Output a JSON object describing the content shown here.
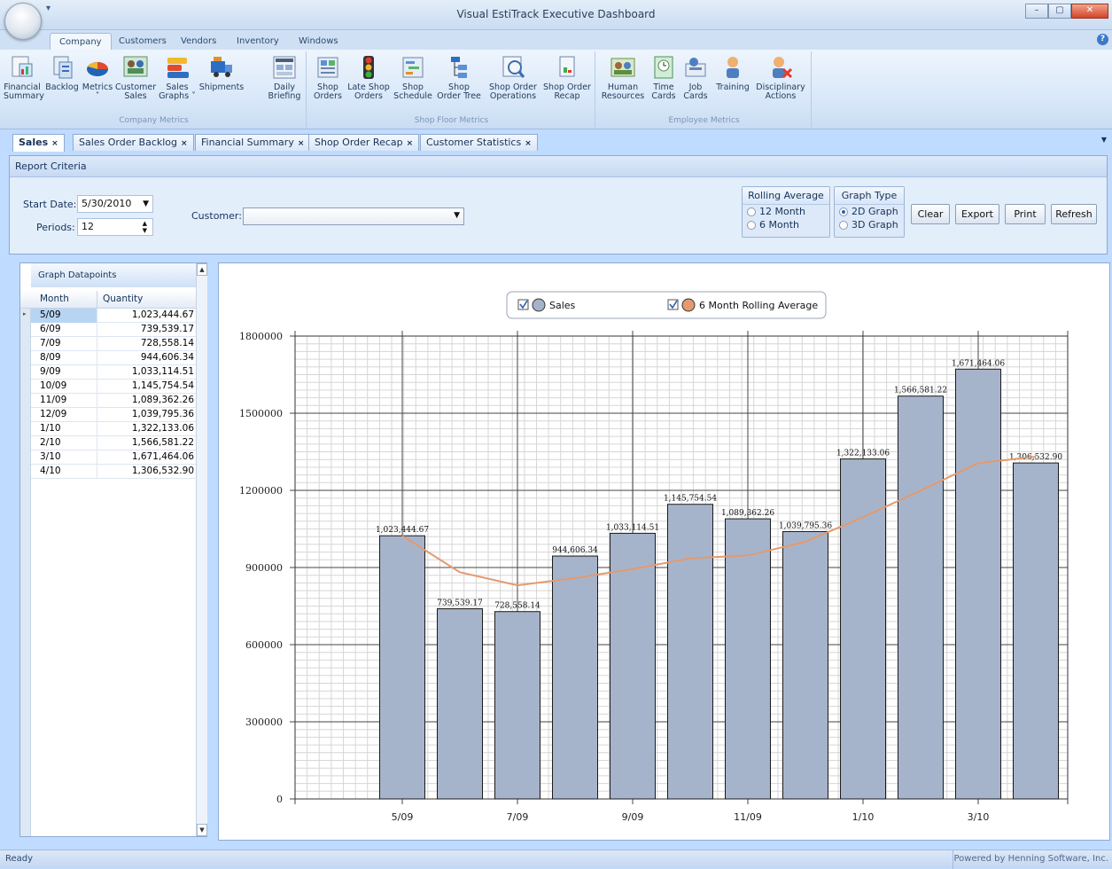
{
  "window": {
    "title": "Visual EstiTrack Executive Dashboard"
  },
  "ribbon_tabs": [
    "Company",
    "Customers",
    "Vendors",
    "Inventory",
    "Windows"
  ],
  "ribbon_groups": [
    {
      "label": "Company Metrics",
      "buttons": [
        {
          "l1": "Financial",
          "l2": "Summary",
          "icon": "financial-summary-icon"
        },
        {
          "l1": "Backlog",
          "l2": "",
          "icon": "backlog-icon"
        },
        {
          "l1": "Metrics",
          "l2": "˅",
          "icon": "metrics-pie-icon"
        },
        {
          "l1": "Customer",
          "l2": "Sales",
          "icon": "customer-sales-icon"
        },
        {
          "l1": "Sales",
          "l2": "Graphs ˅",
          "icon": "sales-graphs-icon"
        },
        {
          "l1": "Shipments",
          "l2": "",
          "icon": "shipments-icon"
        },
        {
          "l1": "Daily",
          "l2": "Briefing",
          "icon": "daily-briefing-icon"
        }
      ]
    },
    {
      "label": "Shop Floor Metrics",
      "buttons": [
        {
          "l1": "Shop",
          "l2": "Orders",
          "icon": "shop-orders-icon"
        },
        {
          "l1": "Late Shop",
          "l2": "Orders",
          "icon": "traffic-light-icon"
        },
        {
          "l1": "Shop",
          "l2": "Schedule",
          "icon": "shop-schedule-icon"
        },
        {
          "l1": "Shop",
          "l2": "Order Tree",
          "icon": "order-tree-icon"
        },
        {
          "l1": "Shop Order",
          "l2": "Operations",
          "icon": "operations-icon"
        },
        {
          "l1": "Shop Order",
          "l2": "Recap",
          "icon": "recap-icon"
        }
      ]
    },
    {
      "label": "Employee Metrics",
      "buttons": [
        {
          "l1": "Human",
          "l2": "Resources",
          "icon": "human-resources-icon"
        },
        {
          "l1": "Time",
          "l2": "Cards",
          "icon": "time-cards-icon"
        },
        {
          "l1": "Job",
          "l2": "Cards",
          "icon": "job-cards-icon"
        },
        {
          "l1": "Training",
          "l2": "",
          "icon": "training-icon"
        },
        {
          "l1": "Disciplinary",
          "l2": "Actions",
          "icon": "disciplinary-actions-icon"
        }
      ]
    }
  ],
  "doc_tabs": [
    "Sales",
    "Sales Order Backlog",
    "Financial Summary",
    "Shop Order Recap",
    "Customer Statistics"
  ],
  "tab_close": "×",
  "criteria": {
    "title": "Report Criteria",
    "start_date_label": "Start Date:",
    "start_date": "5/30/2010",
    "periods_label": "Periods:",
    "periods": "12",
    "customer_label": "Customer:",
    "customer": "",
    "rolling_title": "Rolling Average",
    "rolling_options": [
      "12 Month",
      "6 Month"
    ],
    "graph_type_title": "Graph Type",
    "graph_type_options": [
      "2D Graph",
      "3D Graph"
    ],
    "buttons": [
      "Clear",
      "Export",
      "Print",
      "Refresh"
    ]
  },
  "grid": {
    "title": "Graph Datapoints",
    "columns": [
      "Month",
      "Quantity"
    ],
    "rows": [
      [
        "5/09",
        "1,023,444.67"
      ],
      [
        "6/09",
        "739,539.17"
      ],
      [
        "7/09",
        "728,558.14"
      ],
      [
        "8/09",
        "944,606.34"
      ],
      [
        "9/09",
        "1,033,114.51"
      ],
      [
        "10/09",
        "1,145,754.54"
      ],
      [
        "11/09",
        "1,089,362.26"
      ],
      [
        "12/09",
        "1,039,795.36"
      ],
      [
        "1/10",
        "1,322,133.06"
      ],
      [
        "2/10",
        "1,566,581.22"
      ],
      [
        "3/10",
        "1,671,464.06"
      ],
      [
        "4/10",
        "1,306,532.90"
      ]
    ]
  },
  "chart_data": {
    "type": "bar",
    "categories": [
      "5/09",
      "6/09",
      "7/09",
      "8/09",
      "9/09",
      "10/09",
      "11/09",
      "12/09",
      "1/10",
      "2/10",
      "3/10",
      "4/10"
    ],
    "x_tick_labels": [
      "5/09",
      "7/09",
      "9/09",
      "11/09",
      "1/10",
      "3/10"
    ],
    "y_tick_labels": [
      "0",
      "300000",
      "600000",
      "900000",
      "1200000",
      "1500000",
      "1800000"
    ],
    "ylim": [
      0,
      1800000
    ],
    "grid": true,
    "legend_position": "top-center",
    "series": [
      {
        "name": "Sales",
        "type": "bar",
        "color": "#a6b4cb",
        "values": [
          1023444.67,
          739539.17,
          728558.14,
          944606.34,
          1033114.51,
          1145754.54,
          1089362.26,
          1039795.36,
          1322133.06,
          1566581.22,
          1671464.06,
          1306532.9
        ],
        "labels": [
          "1,023,444.67",
          "739,539.17",
          "728,558.14",
          "944,606.34",
          "1,033,114.51",
          "1,145,754.54",
          "1,089,362.26",
          "1,039,795.36",
          "1,322,133.06",
          "1,566,581.22",
          "1,671,464.06",
          "1,306,532.90"
        ]
      },
      {
        "name": "6 Month Rolling Average",
        "type": "line",
        "color": "#e39a6e",
        "values": [
          1023444.67,
          881491.92,
          830514.0,
          859037.08,
          893852.57,
          935836.23,
          946822.49,
          1000199.19,
          1095837.79,
          1199460.32,
          1305851.83,
          1330978.11
        ]
      }
    ]
  },
  "status": {
    "left": "Ready",
    "right": "Powered by Henning Software, Inc."
  }
}
